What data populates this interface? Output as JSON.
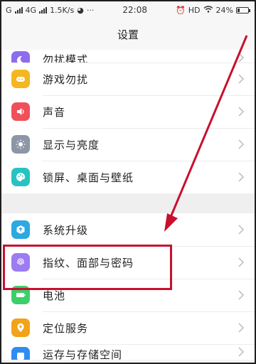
{
  "status_bar": {
    "carrier1": "G",
    "carrier2": "4G",
    "speed": "1.5K/s",
    "time": "22:08",
    "hd": "HD",
    "battery_pct": "24%",
    "battery_level": 0.24
  },
  "header": {
    "title": "设置"
  },
  "group1": [
    {
      "label": "勿扰模式",
      "icon": "moon-icon",
      "color": "#8e6cf0"
    },
    {
      "label": "游戏勿扰",
      "icon": "gamepad-icon",
      "color": "#f5b620"
    },
    {
      "label": "声音",
      "icon": "speaker-icon",
      "color": "#f0505a"
    },
    {
      "label": "显示与亮度",
      "icon": "sun-icon",
      "color": "#8d96a6"
    },
    {
      "label": "锁屏、桌面与壁纸",
      "icon": "palette-icon",
      "color": "#28c3c0"
    }
  ],
  "group2": [
    {
      "label": "系统升级",
      "icon": "upgrade-icon",
      "color": "#2ba9e0"
    },
    {
      "label": "指纹、面部与密码",
      "icon": "fingerprint-icon",
      "color": "#9c7cf2"
    },
    {
      "label": "电池",
      "icon": "battery-icon",
      "color": "#3ccf6a"
    },
    {
      "label": "定位服务",
      "icon": "location-icon",
      "color": "#f2a319"
    },
    {
      "label": "运存与存储空间",
      "icon": "storage-icon",
      "color": "#2f8df2"
    }
  ],
  "annotation": {
    "box_color": "#c8102e",
    "arrow_color": "#c8102e"
  }
}
